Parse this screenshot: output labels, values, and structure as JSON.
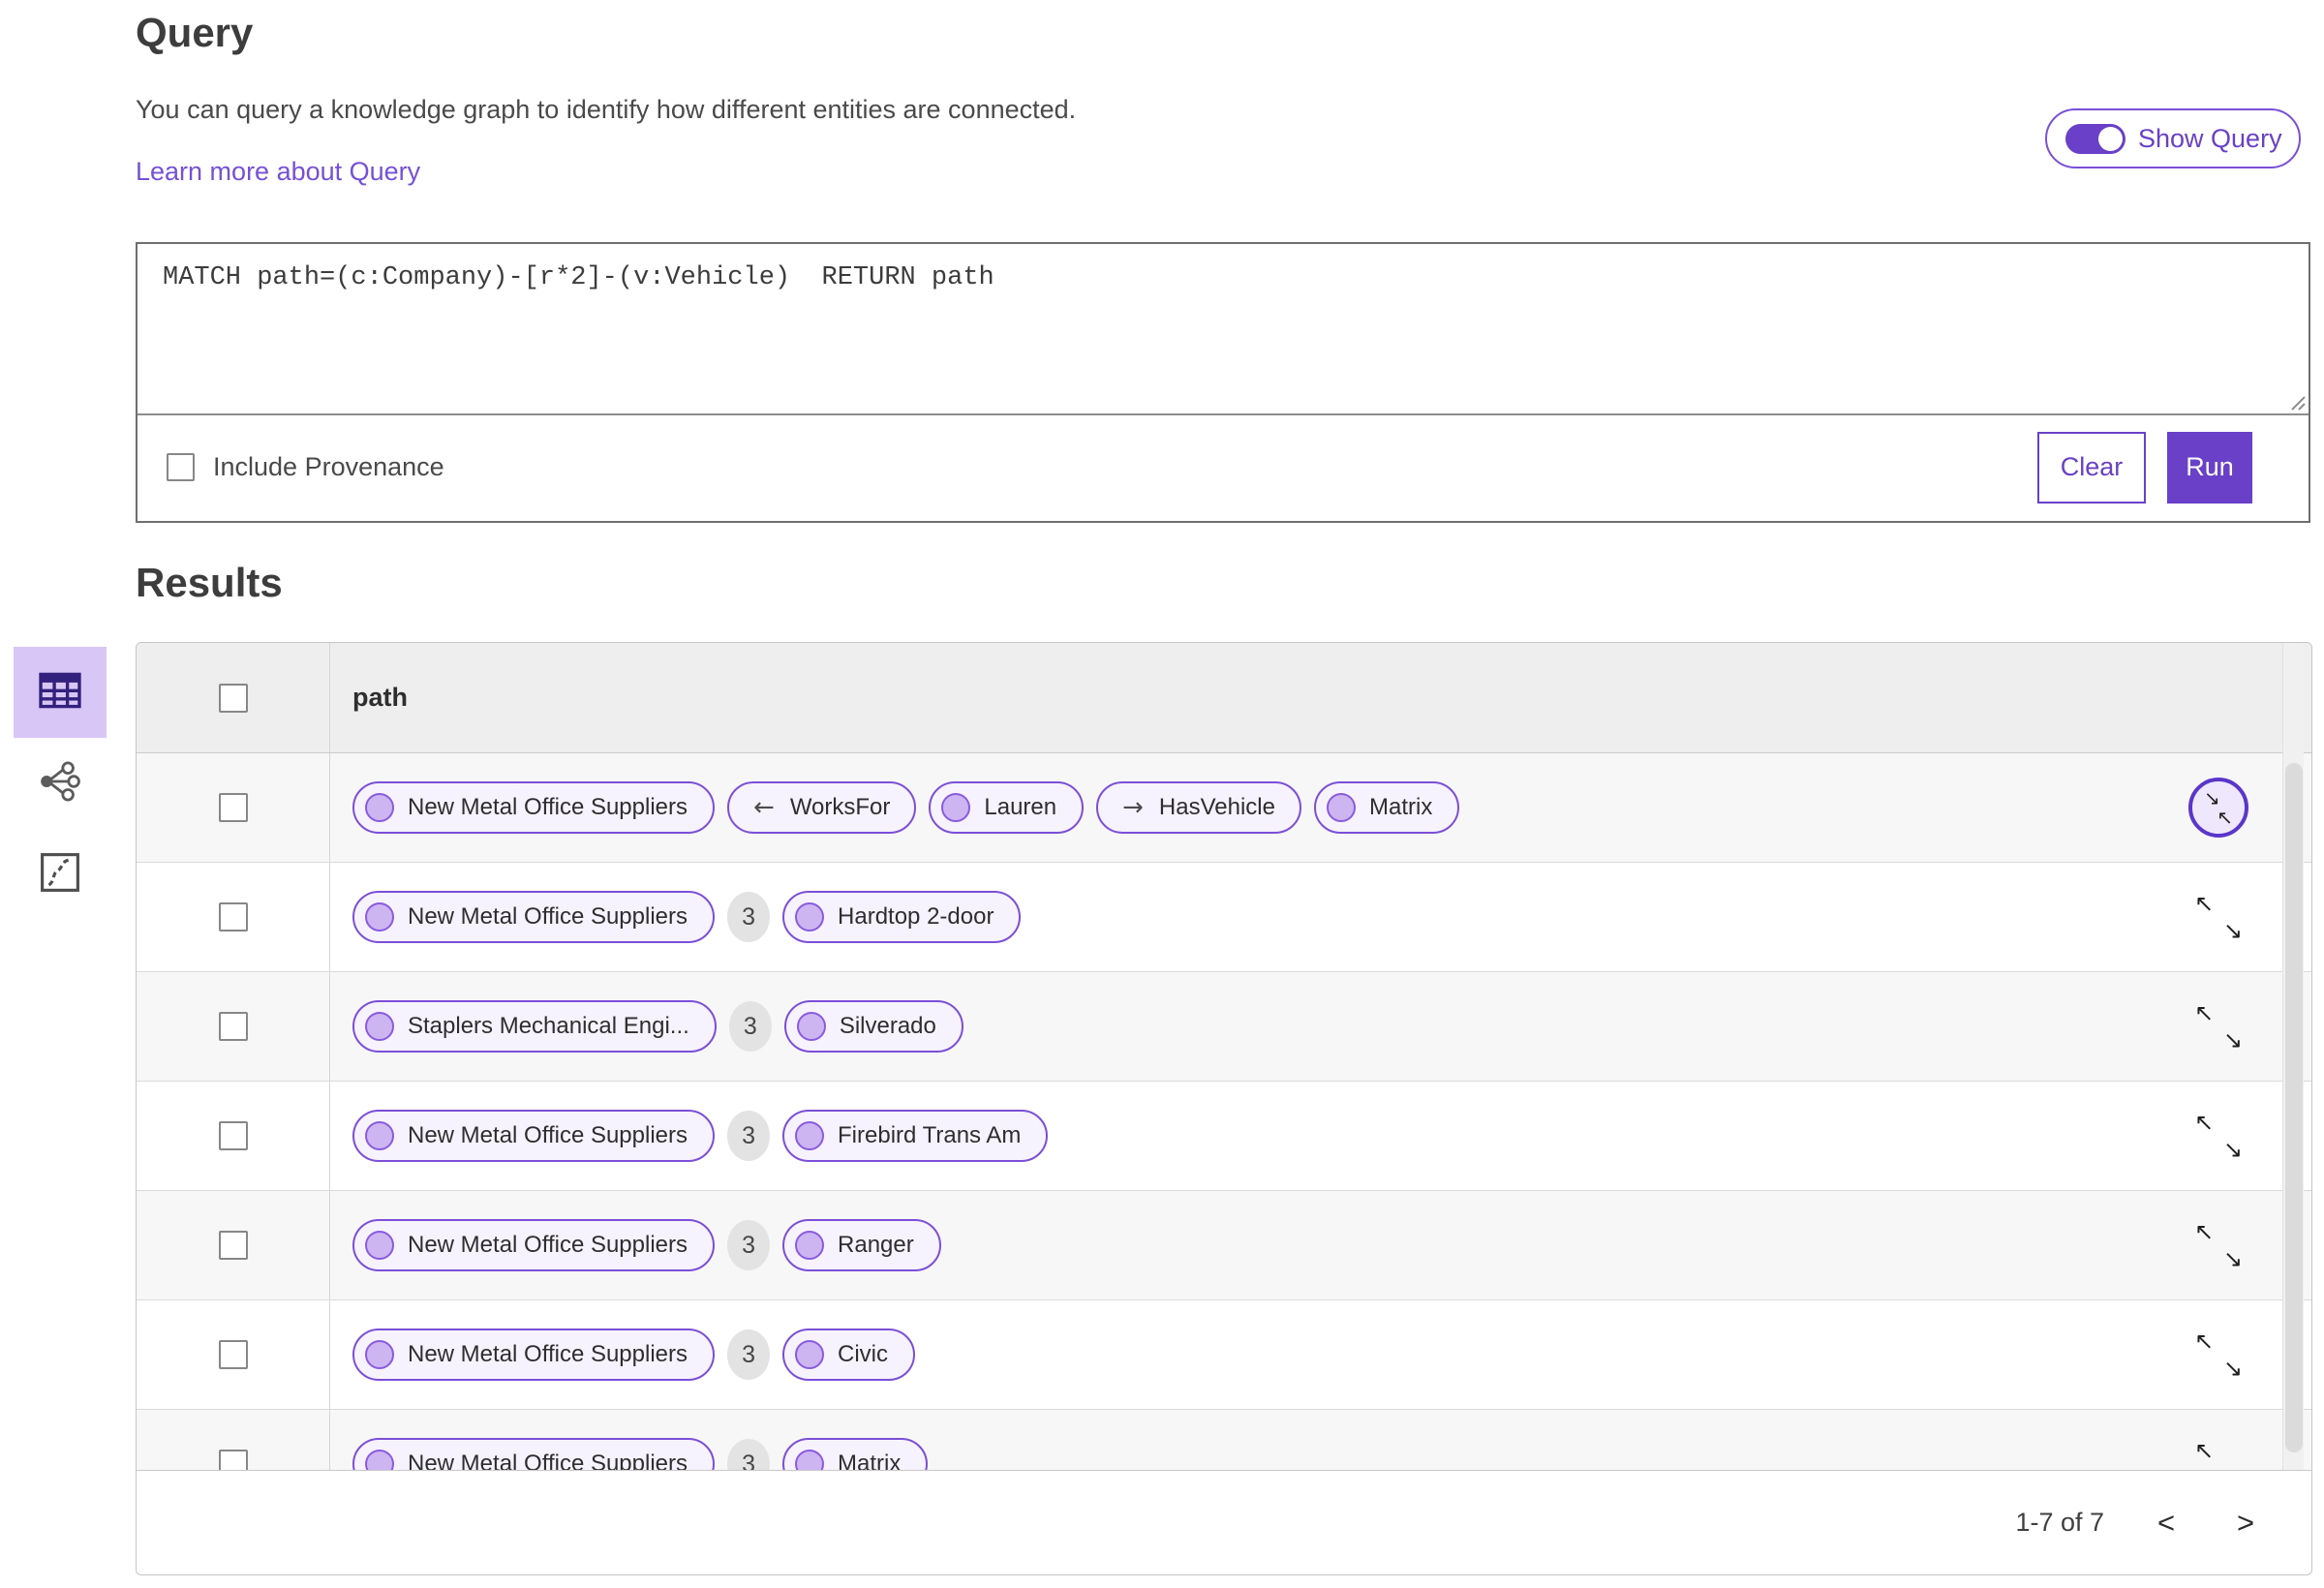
{
  "page": {
    "title": "Query",
    "description": "You can query a knowledge graph to identify how different entities are connected.",
    "learn_more": "Learn more about Query",
    "show_query_label": "Show Query",
    "show_query_on": true
  },
  "query_editor": {
    "text": "MATCH path=(c:Company)-[r*2]-(v:Vehicle)  RETURN path",
    "include_provenance_label": "Include Provenance",
    "include_provenance_checked": false,
    "clear_label": "Clear",
    "run_label": "Run"
  },
  "view_switcher": [
    {
      "name": "table-view",
      "icon": "table-icon",
      "selected": true
    },
    {
      "name": "graph-view",
      "icon": "share-graph-icon",
      "selected": false
    },
    {
      "name": "map-view",
      "icon": "map-icon",
      "selected": false
    }
  ],
  "results": {
    "title": "Results",
    "column_header": "path",
    "rows": [
      {
        "icon": "collapse",
        "items": [
          {
            "type": "entity",
            "label": "New Metal Office Suppliers"
          },
          {
            "type": "rel",
            "dir": "left",
            "label": "WorksFor"
          },
          {
            "type": "entity",
            "label": "Lauren"
          },
          {
            "type": "rel",
            "dir": "right",
            "label": "HasVehicle"
          },
          {
            "type": "entity",
            "label": "Matrix"
          }
        ]
      },
      {
        "icon": "expand",
        "items": [
          {
            "type": "entity",
            "label": "New Metal Office Suppliers"
          },
          {
            "type": "count",
            "label": "3"
          },
          {
            "type": "entity",
            "label": "Hardtop 2-door"
          }
        ]
      },
      {
        "icon": "expand",
        "items": [
          {
            "type": "entity",
            "label": "Staplers Mechanical Engi..."
          },
          {
            "type": "count",
            "label": "3"
          },
          {
            "type": "entity",
            "label": "Silverado"
          }
        ]
      },
      {
        "icon": "expand",
        "items": [
          {
            "type": "entity",
            "label": "New Metal Office Suppliers"
          },
          {
            "type": "count",
            "label": "3"
          },
          {
            "type": "entity",
            "label": "Firebird Trans Am"
          }
        ]
      },
      {
        "icon": "expand",
        "items": [
          {
            "type": "entity",
            "label": "New Metal Office Suppliers"
          },
          {
            "type": "count",
            "label": "3"
          },
          {
            "type": "entity",
            "label": "Ranger"
          }
        ]
      },
      {
        "icon": "expand",
        "items": [
          {
            "type": "entity",
            "label": "New Metal Office Suppliers"
          },
          {
            "type": "count",
            "label": "3"
          },
          {
            "type": "entity",
            "label": "Civic"
          }
        ]
      },
      {
        "icon": "expand",
        "items": [
          {
            "type": "entity",
            "label": "New Metal Office Suppliers"
          },
          {
            "type": "count",
            "label": "3"
          },
          {
            "type": "entity",
            "label": "Matrix"
          }
        ]
      }
    ],
    "pagination": {
      "label": "1-7 of 7",
      "prev": "<",
      "next": ">"
    }
  },
  "colors": {
    "accent_purple": "#6a40c8",
    "pill_border": "#7c4fd8",
    "pill_bg": "#f7f3fe",
    "pill_dot": "#ccb5f1",
    "selected_tile_bg": "#d8c7f6",
    "link": "#7650d9",
    "header_bg": "#efeeef",
    "row_alt_bg": "#f7f7f7",
    "badge_bg": "#e3e3e3"
  }
}
